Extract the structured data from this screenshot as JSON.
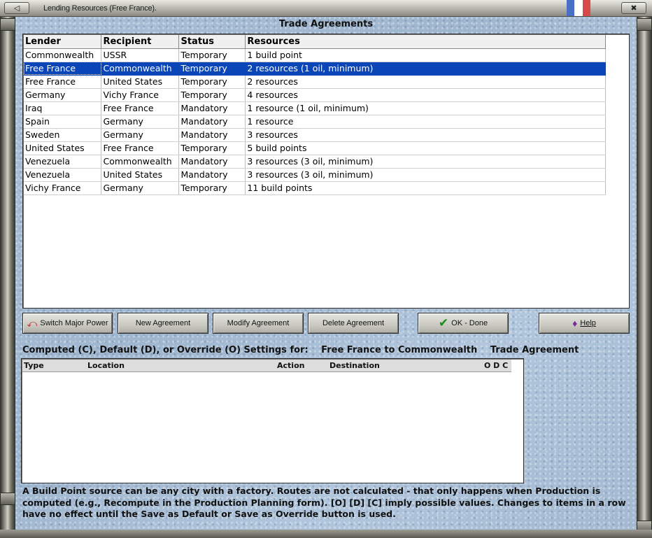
{
  "window": {
    "title": "Lending Resources (Free France).",
    "flag_colors": [
      "#4a6fc7",
      "#ffffff",
      "#d84a4a"
    ]
  },
  "trade": {
    "section_title": "Trade Agreements",
    "columns": [
      "Lender",
      "Recipient",
      "Status",
      "Resources"
    ],
    "rows": [
      [
        "Commonwealth",
        "USSR",
        "Temporary",
        "1 build point"
      ],
      [
        "Free France",
        "Commonwealth",
        "Temporary",
        "2 resources (1 oil, minimum)"
      ],
      [
        "Free France",
        "United States",
        "Temporary",
        "2 resources"
      ],
      [
        "Germany",
        "Vichy France",
        "Temporary",
        "4 resources"
      ],
      [
        "Iraq",
        "Free France",
        "Mandatory",
        "1 resource (1 oil, minimum)"
      ],
      [
        "Spain",
        "Germany",
        "Mandatory",
        "1 resource"
      ],
      [
        "Sweden",
        "Germany",
        "Mandatory",
        "3 resources"
      ],
      [
        "United States",
        "Free France",
        "Temporary",
        "5 build points"
      ],
      [
        "Venezuela",
        "Commonwealth",
        "Mandatory",
        "3 resources (3 oil, minimum)"
      ],
      [
        "Venezuela",
        "United States",
        "Mandatory",
        "3 resources (3 oil, minimum)"
      ],
      [
        "Vichy France",
        "Germany",
        "Temporary",
        "11 build points"
      ]
    ],
    "selected_row": 1
  },
  "buttons": {
    "switch": "Switch Major Power",
    "new": "New Agreement",
    "modify": "Modify Agreement",
    "delete": "Delete Agreement",
    "ok": "OK - Done",
    "help": "Help"
  },
  "settings": {
    "caption": "Computed (C), Default (D), or Override (O) Settings for:",
    "subject": "Free France to Commonwealth",
    "kind": "Trade Agreement",
    "columns": {
      "type": "Type",
      "location": "Location",
      "action": "Action",
      "destination": "Destination",
      "odc": "O D C"
    }
  },
  "note": "A Build Point source can be any city with a factory. Routes are not calculated - that only happens when Production is computed (e.g., Recompute in the Production Planning form).  [O] [D] [C] imply possible values.  Changes to items in a row have no effect until the Save as Default or Save as Override button is used."
}
